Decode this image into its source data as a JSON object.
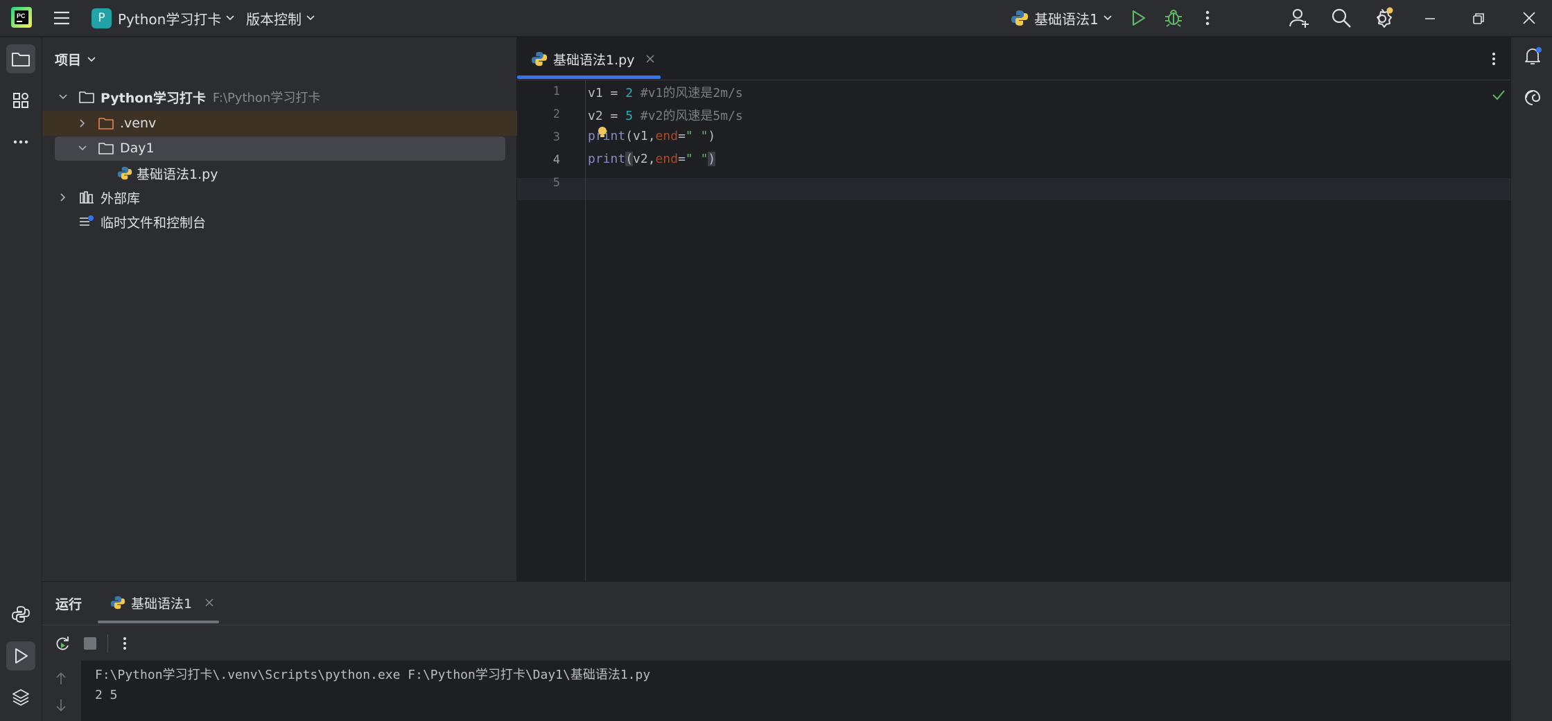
{
  "titlebar": {
    "project_name": "Python学习打卡",
    "project_initial": "P",
    "vcs_label": "版本控制",
    "run_config": "基础语法1"
  },
  "project_panel": {
    "title": "项目",
    "tree": [
      {
        "label": "Python学习打卡",
        "path": "F:\\Python学习打卡"
      },
      {
        "label": ".venv"
      },
      {
        "label": "Day1"
      },
      {
        "label": "基础语法1.py"
      },
      {
        "label": "外部库"
      },
      {
        "label": "临时文件和控制台"
      }
    ]
  },
  "editor": {
    "tab_label": "基础语法1.py",
    "line_numbers": [
      "1",
      "2",
      "3",
      "4",
      "5"
    ],
    "lines": [
      {
        "var": "v1",
        "op": " = ",
        "num": "2",
        "comment": " #v1的风速是2m/s"
      },
      {
        "var": "v2",
        "op": " = ",
        "num": "5",
        "comment": " #v2的风速是5m/s"
      },
      {
        "fn": "print",
        "open": "(",
        "arg": "v1,",
        "kw": "end",
        "eq": "=",
        "str": "\" \"",
        "close": ")"
      },
      {
        "fn": "print",
        "open": "(",
        "arg": "v2,",
        "kw": "end",
        "eq": "=",
        "str": "\" \"",
        "close": ")"
      }
    ]
  },
  "run_panel": {
    "title": "运行",
    "tab_label": "基础语法1",
    "output": [
      "F:\\Python学习打卡\\.venv\\Scripts\\python.exe F:\\Python学习打卡\\Day1\\基础语法1.py",
      "2 5"
    ]
  },
  "colors": {
    "accent": "#3574f0",
    "run_green": "#5fb865",
    "background": "#1e1f22",
    "panel": "#2b2d30"
  }
}
